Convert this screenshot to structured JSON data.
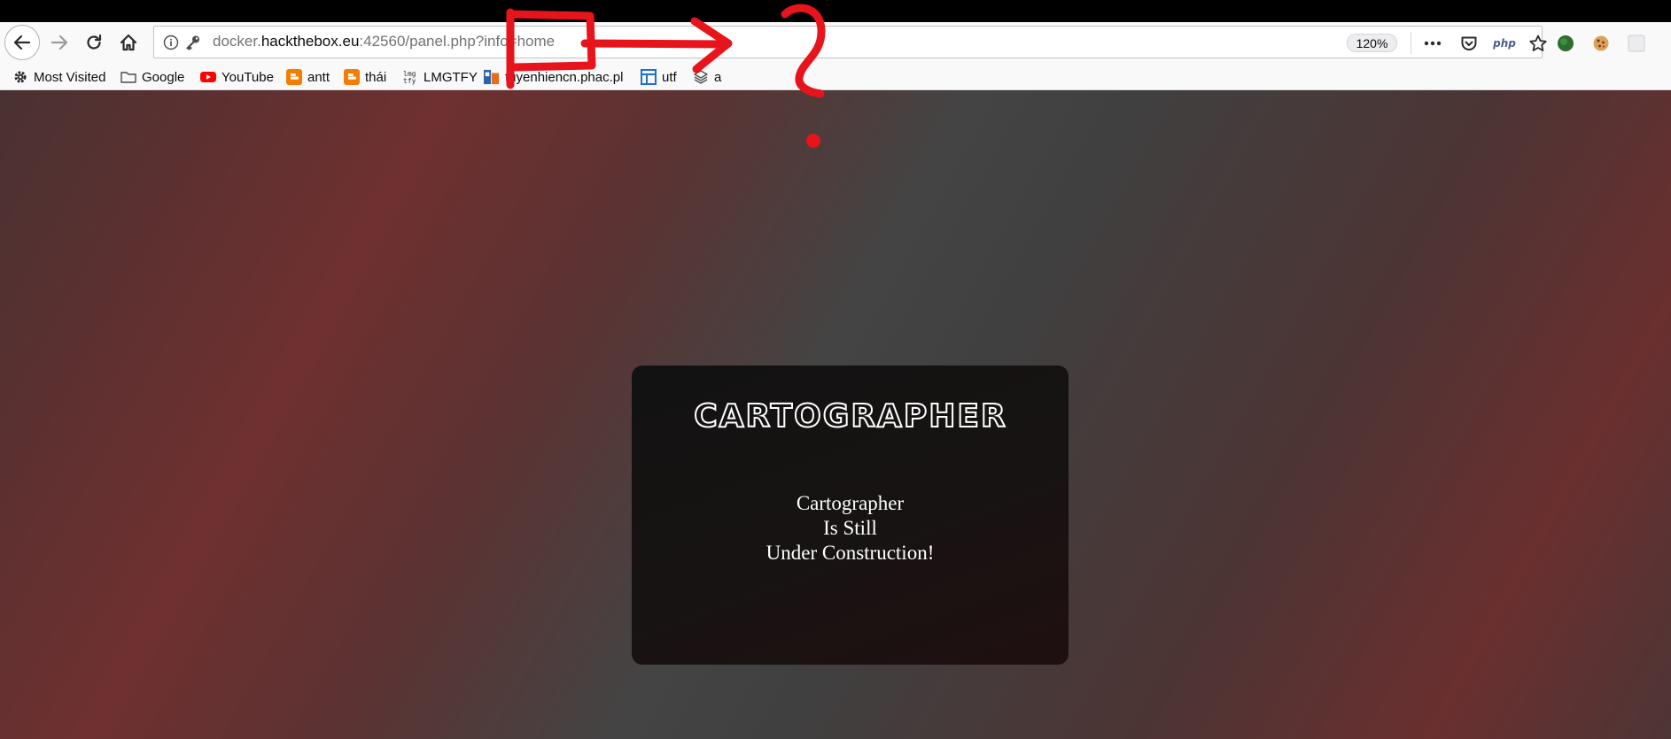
{
  "browser": {
    "url": {
      "prefix": "docker.",
      "host": "hackthebox.eu",
      "rest": ":42560/panel.php?info=home"
    },
    "zoom": "120%",
    "php_badge": "php",
    "icons": {
      "back": "back-arrow-icon",
      "forward": "forward-arrow-icon",
      "reload": "reload-icon",
      "home": "home-icon",
      "info": "info-icon",
      "key": "key-icon",
      "page_actions": "meatball-menu-icon",
      "pocket": "pocket-icon",
      "bookmark": "star-icon"
    }
  },
  "bookmarks": [
    {
      "label": "Most Visited",
      "icon": "gear-icon"
    },
    {
      "label": "Google",
      "icon": "folder-icon"
    },
    {
      "label": "YouTube",
      "icon": "youtube-icon"
    },
    {
      "label": "antt",
      "icon": "blogger-icon"
    },
    {
      "label": "thái",
      "icon": "blogger-icon"
    },
    {
      "label": "LMGTFY",
      "icon": "lmgtfy-icon"
    },
    {
      "label": "tuyenhiencn.phac.pl",
      "icon": "site-icon"
    },
    {
      "label": "utf",
      "icon": "table-icon"
    },
    {
      "label": "a",
      "icon": "layers-icon"
    }
  ],
  "card": {
    "logo_text": "CARTOGRAPHER",
    "line1": "Cartographer",
    "line2": "Is Still",
    "line3": "Under Construction!"
  },
  "colors": {
    "annotation": "#e8141c",
    "bg_gray": "#404040",
    "bg_red": "#6f3030",
    "card": "#141212"
  }
}
